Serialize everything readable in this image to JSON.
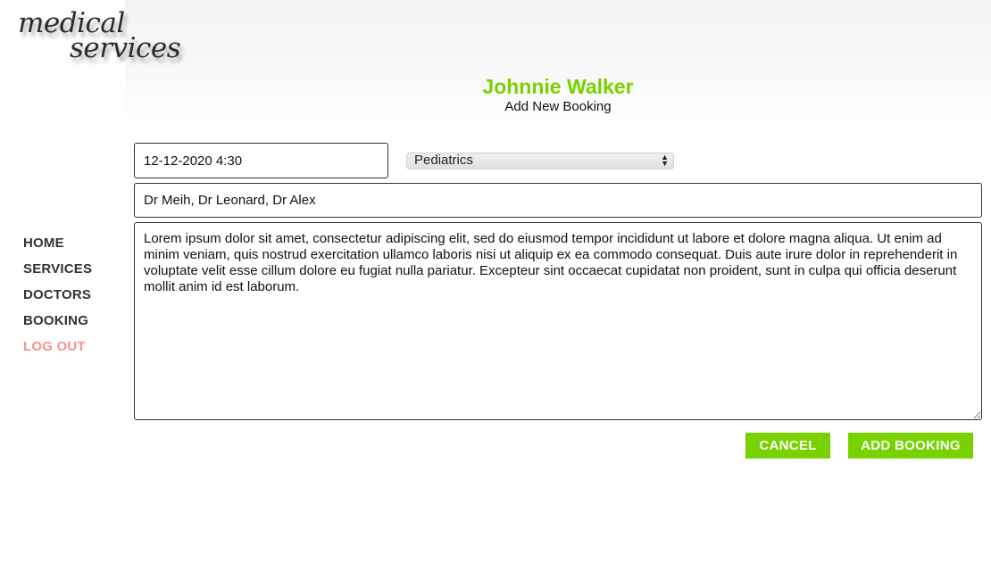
{
  "brand": {
    "logo_line1": "medical",
    "logo_line2": "services"
  },
  "header": {
    "patient_name": "Johnnie Walker",
    "subtitle": "Add New Booking"
  },
  "nav": {
    "items": [
      {
        "label": "HOME"
      },
      {
        "label": "SERVICES"
      },
      {
        "label": "DOCTORS"
      },
      {
        "label": "BOOKING"
      },
      {
        "label": "LOG OUT"
      }
    ]
  },
  "form": {
    "datetime_value": "12-12-2020 4:30",
    "specialty_selected": "Pediatrics",
    "doctors_value": "Dr Meih, Dr Leonard, Dr Alex",
    "notes_value": "Lorem ipsum dolor sit amet, consectetur adipiscing elit, sed do eiusmod tempor incididunt ut labore et dolore magna aliqua. Ut enim ad minim veniam, quis nostrud exercitation ullamco laboris nisi ut aliquip ex ea commodo consequat. Duis aute irure dolor in reprehenderit in voluptate velit esse cillum dolore eu fugiat nulla pariatur. Excepteur sint occaecat cupidatat non proident, sunt in culpa qui officia deserunt mollit anim id est laborum."
  },
  "actions": {
    "cancel_label": "CANCEL",
    "add_label": "ADD BOOKING"
  },
  "colors": {
    "accent": "#78d200",
    "logout": "#f39393",
    "nav_text": "#333333"
  }
}
